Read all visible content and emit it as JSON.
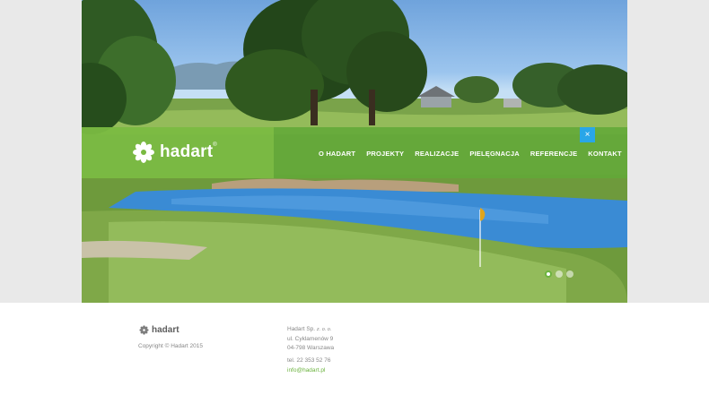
{
  "brand": {
    "logo_text": "hadart",
    "logo_mark": "®"
  },
  "navigation": {
    "items": [
      {
        "label": "O HADART"
      },
      {
        "label": "PROJEKTY"
      },
      {
        "label": "REALIZACJE"
      },
      {
        "label": "PIELĘGNACJA"
      },
      {
        "label": "REFERENCJE"
      },
      {
        "label": "KONTAKT"
      }
    ],
    "close_label": "×"
  },
  "slider": {
    "slide_count": 3,
    "active_slide": 1
  },
  "footer": {
    "logo_text": "hadart",
    "copyright": "Copyright © Hadart 2015",
    "company_name": "Hadart Sp.",
    "company_suffix": "z. o. o.",
    "street": "ul. Cyklamenów 9",
    "city": "04-798 Warszawa",
    "phone": "tel. 22 353 52 76",
    "email": "info@hadart.pl"
  },
  "colors": {
    "brand_green": "#6cb33f",
    "close_button_blue": "#29a6e8"
  }
}
